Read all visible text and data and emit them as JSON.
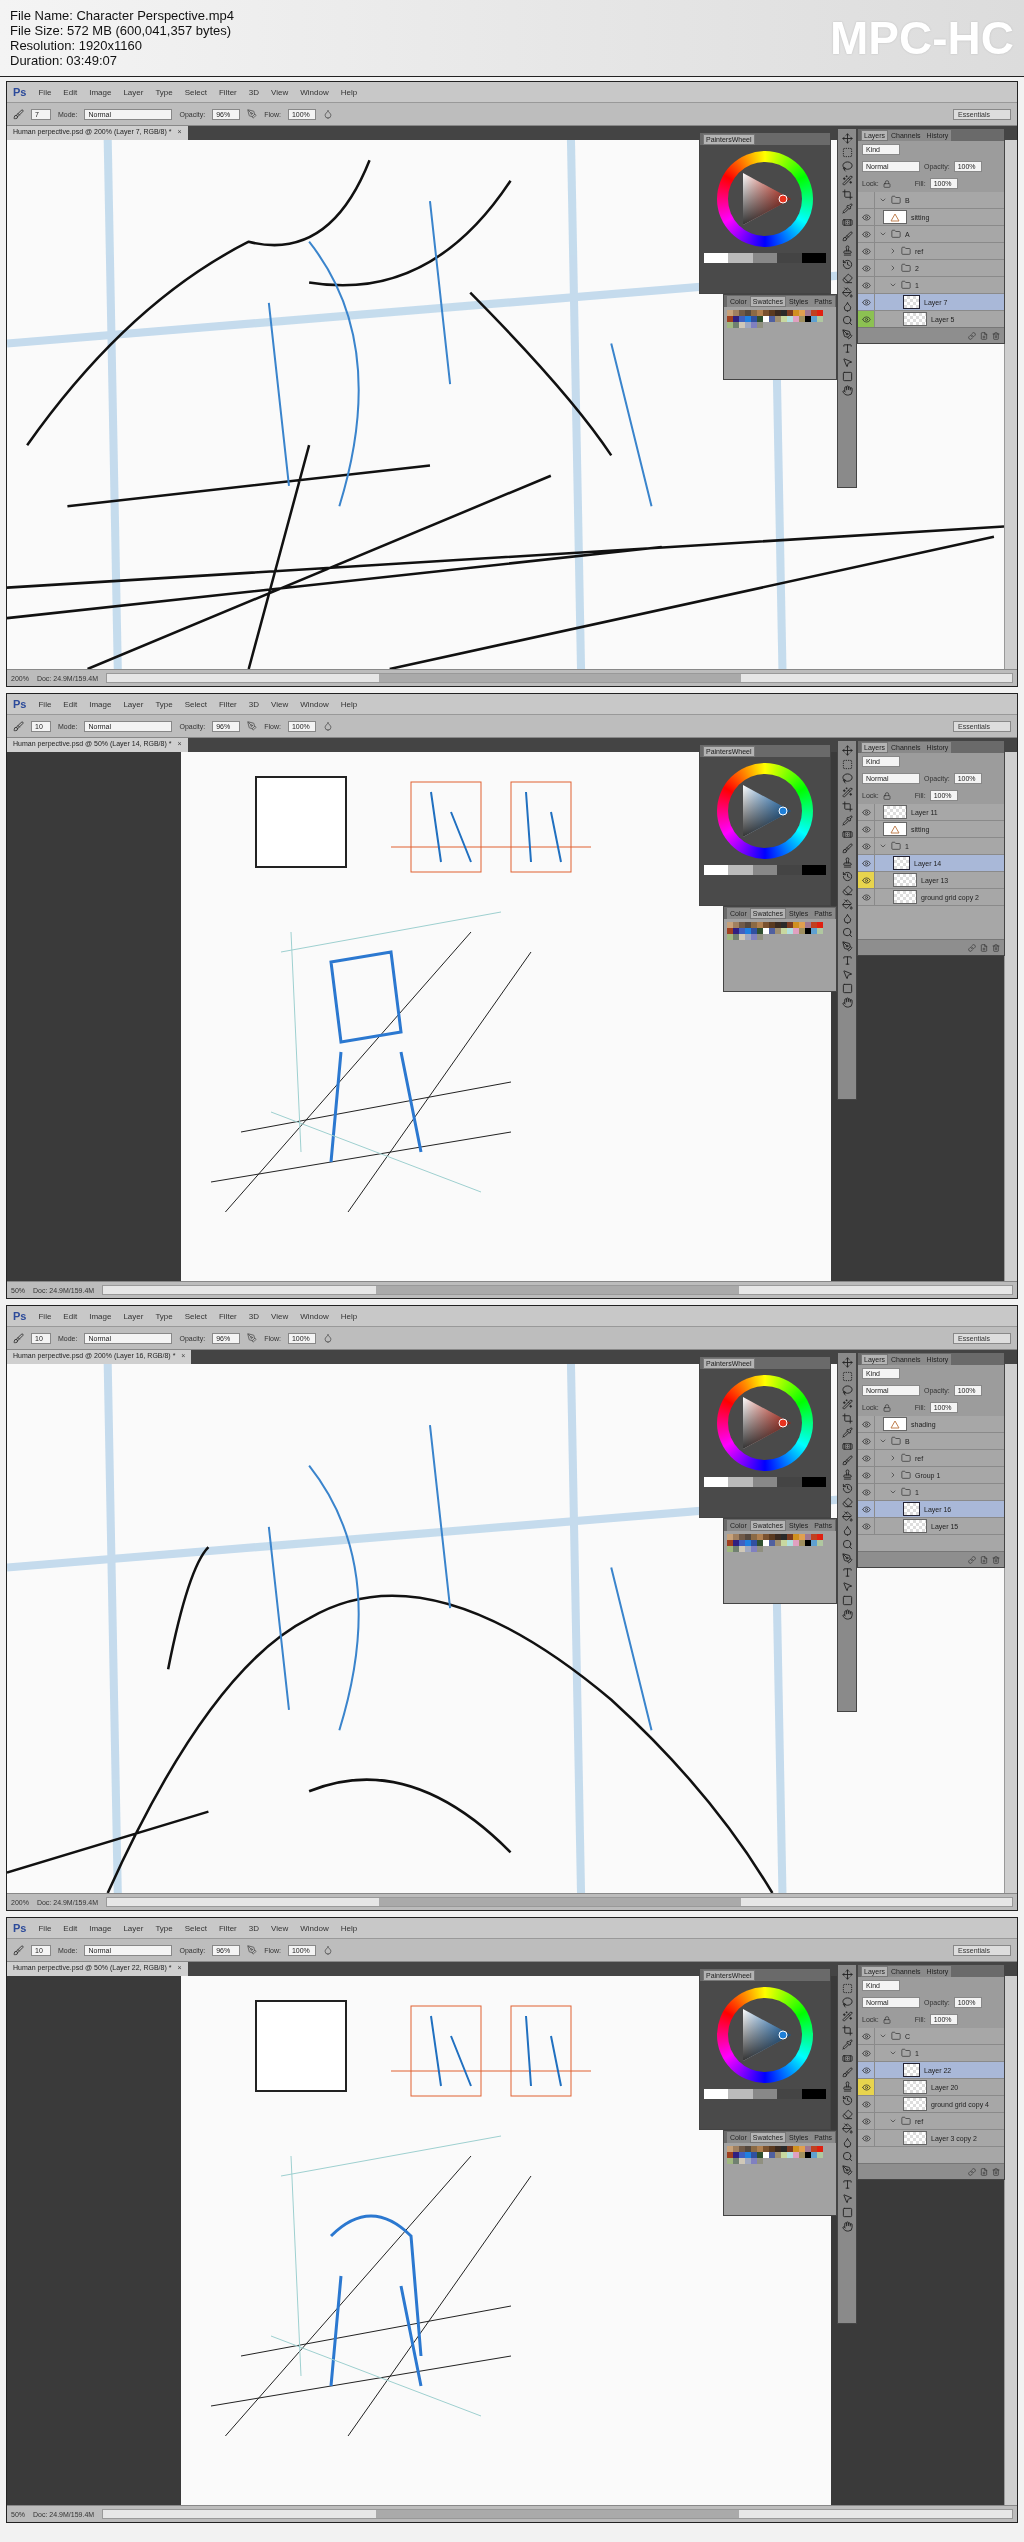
{
  "info": [
    "File Name: Character Perspective.mp4",
    "File Size: 572 MB (600,041,357 bytes)",
    "Resolution: 1920x1160",
    "Duration: 03:49:07"
  ],
  "logo": "MPC-HC",
  "frames": [
    {
      "app": "Ps",
      "menus": [
        "File",
        "Edit",
        "Image",
        "Layer",
        "Type",
        "Select",
        "Filter",
        "3D",
        "View",
        "Window",
        "Help"
      ],
      "options": {
        "brush_size": "7",
        "mode_label": "Mode:",
        "mode": "Normal",
        "opacity_label": "Opacity:",
        "opacity": "96%",
        "flow_label": "Flow:",
        "flow": "100%",
        "workspace": "Essentials"
      },
      "document_tab": "Human perpective.psd @ 200% (Layer 7, RGB/8) *",
      "close": "×",
      "kind": "closeup",
      "zoom": "200%",
      "doc_size": "Doc: 24.9M/159.4M",
      "wheel": {
        "title": "PaintersWheel",
        "color": "#e8321e"
      },
      "swatch_tabs": [
        {
          "label": "Color",
          "selected": false
        },
        {
          "label": "Swatches",
          "selected": true
        },
        {
          "label": "Styles",
          "selected": false
        },
        {
          "label": "Paths",
          "selected": false
        }
      ],
      "layer_tabs": [
        {
          "label": "Layers",
          "selected": true
        },
        {
          "label": "Channels",
          "selected": false
        },
        {
          "label": "History",
          "selected": false
        }
      ],
      "filter": "Kind",
      "blend": "Normal",
      "opacity_label": "Opacity:",
      "opacity": "100%",
      "lock_label": "Lock:",
      "fill_label": "Fill:",
      "fill": "100%",
      "layers": [
        {
          "kind": "group",
          "name": "B",
          "visible": false,
          "selected": false,
          "expanded": true
        },
        {
          "kind": "image",
          "name": "sitting",
          "visible": true,
          "selected": false
        },
        {
          "kind": "group",
          "name": "A",
          "visible": true,
          "selected": false,
          "expanded": true,
          "children": [
            {
              "kind": "group",
              "name": "ref",
              "visible": true,
              "selected": false,
              "expanded": false
            },
            {
              "kind": "group",
              "name": "2",
              "visible": true,
              "selected": false,
              "expanded": false
            },
            {
              "kind": "group",
              "name": "1",
              "visible": true,
              "selected": false,
              "expanded": true,
              "children": [
                {
                  "kind": "layer",
                  "name": "Layer 7",
                  "visible": true,
                  "selected": true
                },
                {
                  "kind": "layer",
                  "name": "Layer 5",
                  "visible": true,
                  "selected": false,
                  "color": "#8cc152"
                }
              ]
            }
          ]
        }
      ]
    },
    {
      "app": "Ps",
      "menus": [
        "File",
        "Edit",
        "Image",
        "Layer",
        "Type",
        "Select",
        "Filter",
        "3D",
        "View",
        "Window",
        "Help"
      ],
      "options": {
        "brush_size": "10",
        "mode_label": "Mode:",
        "mode": "Normal",
        "opacity_label": "Opacity:",
        "opacity": "96%",
        "flow_label": "Flow:",
        "flow": "100%",
        "workspace": "Essentials"
      },
      "document_tab": "Human perpective.psd @ 50% (Layer 14, RGB/8) *",
      "close": "×",
      "kind": "document",
      "zoom": "50%",
      "doc_size": "Doc: 24.9M/159.4M",
      "wheel": {
        "title": "PaintersWheel",
        "color": "#1e7fd8"
      },
      "swatch_tabs": [
        {
          "label": "Color",
          "selected": false
        },
        {
          "label": "Swatches",
          "selected": true
        },
        {
          "label": "Styles",
          "selected": false
        },
        {
          "label": "Paths",
          "selected": false
        }
      ],
      "layer_tabs": [
        {
          "label": "Layers",
          "selected": true
        },
        {
          "label": "Channels",
          "selected": false
        },
        {
          "label": "History",
          "selected": false
        }
      ],
      "filter": "Kind",
      "blend": "Normal",
      "opacity_label": "Opacity:",
      "opacity": "100%",
      "lock_label": "Lock:",
      "fill_label": "Fill:",
      "fill": "100%",
      "layers": [
        {
          "kind": "layer",
          "name": "Layer 11",
          "visible": true,
          "selected": false
        },
        {
          "kind": "image",
          "name": "sitting",
          "visible": true,
          "selected": false
        },
        {
          "kind": "group",
          "name": "1",
          "visible": true,
          "selected": false,
          "expanded": true,
          "children": [
            {
              "kind": "layer",
              "name": "Layer 14",
              "visible": true,
              "selected": true
            },
            {
              "kind": "layer",
              "name": "Layer 13",
              "visible": true,
              "selected": false,
              "color": "#e8d44d"
            },
            {
              "kind": "layer",
              "name": "ground grid copy 2",
              "visible": true,
              "selected": false
            }
          ]
        }
      ]
    },
    {
      "app": "Ps",
      "menus": [
        "File",
        "Edit",
        "Image",
        "Layer",
        "Type",
        "Select",
        "Filter",
        "3D",
        "View",
        "Window",
        "Help"
      ],
      "options": {
        "brush_size": "10",
        "mode_label": "Mode:",
        "mode": "Normal",
        "opacity_label": "Opacity:",
        "opacity": "96%",
        "flow_label": "Flow:",
        "flow": "100%",
        "workspace": "Essentials"
      },
      "document_tab": "Human perpective.psd @ 200% (Layer 16, RGB/8) *",
      "close": "×",
      "kind": "closeup",
      "zoom": "200%",
      "doc_size": "Doc: 24.9M/159.4M",
      "wheel": {
        "title": "PaintersWheel",
        "color": "#e8321e"
      },
      "swatch_tabs": [
        {
          "label": "Color",
          "selected": false
        },
        {
          "label": "Swatches",
          "selected": true
        },
        {
          "label": "Styles",
          "selected": false
        },
        {
          "label": "Paths",
          "selected": false
        }
      ],
      "layer_tabs": [
        {
          "label": "Layers",
          "selected": true
        },
        {
          "label": "Channels",
          "selected": false
        },
        {
          "label": "History",
          "selected": false
        }
      ],
      "filter": "Kind",
      "blend": "Normal",
      "opacity_label": "Opacity:",
      "opacity": "100%",
      "lock_label": "Lock:",
      "fill_label": "Fill:",
      "fill": "100%",
      "layers": [
        {
          "kind": "image",
          "name": "shading",
          "visible": true,
          "selected": false
        },
        {
          "kind": "group",
          "name": "B",
          "visible": true,
          "selected": false,
          "expanded": true,
          "children": [
            {
              "kind": "group",
              "name": "ref",
              "visible": true,
              "selected": false,
              "expanded": false
            },
            {
              "kind": "group",
              "name": "Group 1",
              "visible": true,
              "selected": false,
              "expanded": false
            },
            {
              "kind": "group",
              "name": "1",
              "visible": true,
              "selected": false,
              "expanded": true,
              "children": [
                {
                  "kind": "layer",
                  "name": "Layer 16",
                  "visible": true,
                  "selected": true
                },
                {
                  "kind": "layer",
                  "name": "Layer 15",
                  "visible": true,
                  "selected": false
                }
              ]
            }
          ]
        }
      ]
    },
    {
      "app": "Ps",
      "menus": [
        "File",
        "Edit",
        "Image",
        "Layer",
        "Type",
        "Select",
        "Filter",
        "3D",
        "View",
        "Window",
        "Help"
      ],
      "options": {
        "brush_size": "10",
        "mode_label": "Mode:",
        "mode": "Normal",
        "opacity_label": "Opacity:",
        "opacity": "96%",
        "flow_label": "Flow:",
        "flow": "100%",
        "workspace": "Essentials"
      },
      "document_tab": "Human perpective.psd @ 50% (Layer 22, RGB/8) *",
      "close": "×",
      "kind": "document",
      "zoom": "50%",
      "doc_size": "Doc: 24.9M/159.4M",
      "wheel": {
        "title": "PaintersWheel",
        "color": "#1e7fd8"
      },
      "swatch_tabs": [
        {
          "label": "Color",
          "selected": false
        },
        {
          "label": "Swatches",
          "selected": true
        },
        {
          "label": "Styles",
          "selected": false
        },
        {
          "label": "Paths",
          "selected": false
        }
      ],
      "layer_tabs": [
        {
          "label": "Layers",
          "selected": true
        },
        {
          "label": "Channels",
          "selected": false
        },
        {
          "label": "History",
          "selected": false
        }
      ],
      "filter": "Kind",
      "blend": "Normal",
      "opacity_label": "Opacity:",
      "opacity": "100%",
      "lock_label": "Lock:",
      "fill_label": "Fill:",
      "fill": "100%",
      "layers": [
        {
          "kind": "group",
          "name": "C",
          "visible": true,
          "selected": false,
          "expanded": true,
          "children": [
            {
              "kind": "group",
              "name": "1",
              "visible": true,
              "selected": false,
              "expanded": true,
              "children": [
                {
                  "kind": "layer",
                  "name": "Layer 22",
                  "visible": true,
                  "selected": true
                },
                {
                  "kind": "layer",
                  "name": "Layer 20",
                  "visible": true,
                  "selected": false,
                  "color": "#e8d44d"
                },
                {
                  "kind": "layer",
                  "name": "ground grid copy 4",
                  "visible": true,
                  "selected": false
                }
              ]
            },
            {
              "kind": "group",
              "name": "ref",
              "visible": true,
              "selected": false,
              "expanded": true,
              "children": [
                {
                  "kind": "layer",
                  "name": "Layer 3 copy 2",
                  "visible": true,
                  "selected": false
                }
              ]
            }
          ]
        }
      ]
    }
  ]
}
